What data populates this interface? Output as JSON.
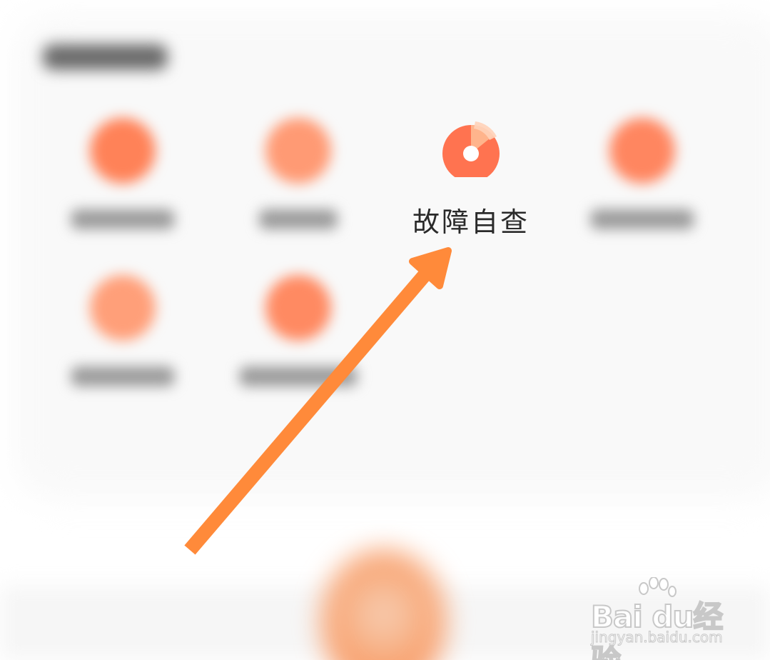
{
  "section": {
    "title_blurred": true
  },
  "tools": [
    {
      "id": "tool-1",
      "color": "#ff8258"
    },
    {
      "id": "tool-2",
      "color": "#ff9a74"
    },
    {
      "id": "tool-self-check",
      "label": "故障自查",
      "color": "#ff7350",
      "accent": "#ffb48c"
    },
    {
      "id": "tool-4",
      "color": "#ff8660"
    },
    {
      "id": "tool-5",
      "color": "#ff9f79"
    },
    {
      "id": "tool-6",
      "color": "#ff8a62"
    }
  ],
  "annotation": {
    "arrow_color": "#ff8a3a",
    "target": "故障自查"
  },
  "watermark": {
    "brand": "Bai du经验",
    "url": "jingyan.baidu.com"
  }
}
